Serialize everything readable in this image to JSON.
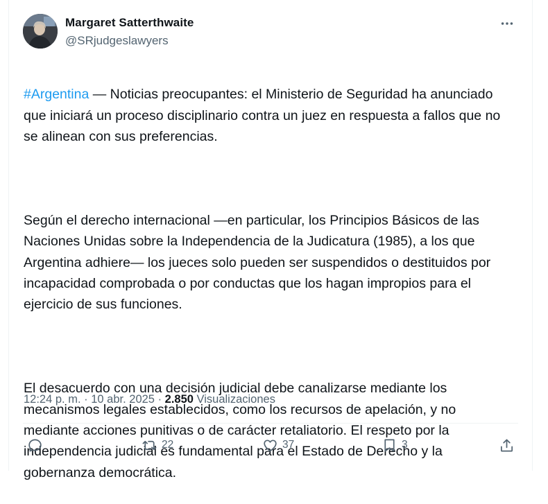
{
  "author": {
    "name": "Margaret Satterthwaite",
    "handle": "@SRjudgeslawyers"
  },
  "tweet": {
    "hashtag": "#Argentina",
    "p1_rest": " — Noticias preocupantes: el Ministerio de Seguridad ha anunciado que iniciará un proceso disciplinario contra un juez en respuesta a fallos que no se alinean con sus preferencias.",
    "p2": "Según el derecho internacional —en particular, los Principios Básicos de las Naciones Unidas sobre la Independencia de la Judicatura (1985), a los que Argentina adhiere— los jueces solo pueden ser suspendidos o destituidos por incapacidad comprobada o por conductas que los hagan impropios para el ejercicio de sus funciones.",
    "p3": "El desacuerdo con una decisión judicial debe canalizarse mediante los mecanismos legales establecidos, como los recursos de apelación, y no mediante acciones punitivas o de carácter retaliatorio. El respeto por la independencia judicial es fundamental para el Estado de Derecho y la gobernanza democrática."
  },
  "meta": {
    "time": "12:24 p. m.",
    "sep1": " · ",
    "date": "10 abr. 2025",
    "sep2": " · ",
    "views_count": "2.850",
    "views_label": " Visualizaciones"
  },
  "actions": {
    "reply_icon": "reply-icon",
    "retweet_icon": "retweet-icon",
    "retweet_count": "22",
    "like_icon": "heart-icon",
    "like_count": "37",
    "bookmark_icon": "bookmark-icon",
    "bookmark_count": "3",
    "share_icon": "share-icon",
    "more_icon": "more-icon"
  },
  "colors": {
    "hashtag": "#1d9bf0",
    "secondary_text": "#536471",
    "primary_text": "#0f1419"
  }
}
